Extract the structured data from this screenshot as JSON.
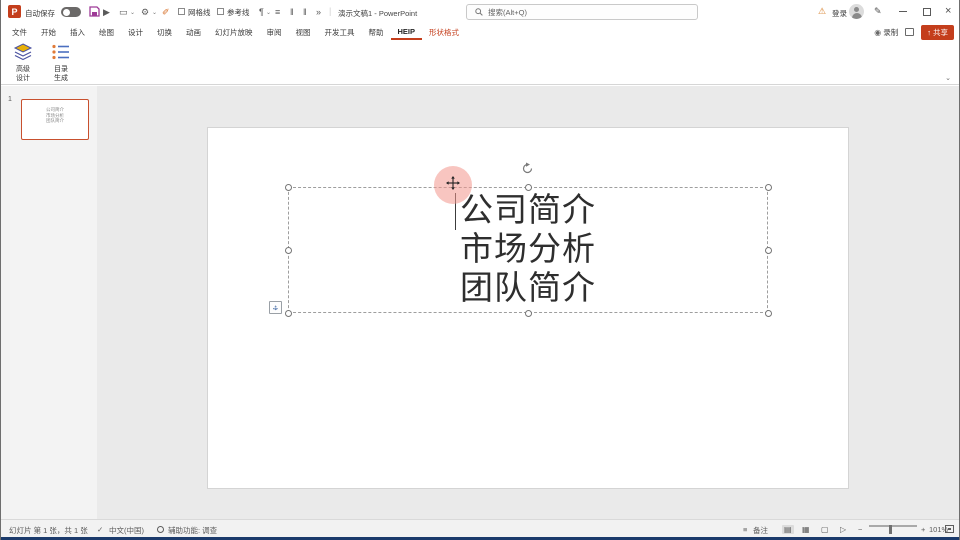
{
  "titlebar": {
    "autosave_label": "自动保存",
    "doc_title": "演示文稿1 - PowerPoint",
    "search_placeholder": "搜索(Alt+Q)",
    "signin_label": "登录",
    "gridlines_label": "网格线",
    "guides_label": "参考线"
  },
  "ribbon": {
    "tabs": [
      "文件",
      "开始",
      "插入",
      "绘图",
      "设计",
      "切换",
      "动画",
      "幻灯片放映",
      "审阅",
      "视图",
      "开发工具",
      "帮助",
      "HEIP",
      "形状格式"
    ],
    "record_label": "录制",
    "share_label": "共享",
    "design_button": {
      "line1": "高级",
      "line2": "设计"
    },
    "toc_button": {
      "line1": "目录",
      "line2": "生成"
    }
  },
  "slides_panel": {
    "slide_number": "1"
  },
  "slide": {
    "lines": [
      "公司简介",
      "市场分析",
      "团队简介"
    ]
  },
  "statusbar": {
    "slide_info": "幻灯片 第 1 张，共 1 张",
    "spell_glyph": "✓",
    "language": "中文(中国)",
    "accessibility": "辅助功能: 调查",
    "notes_label": "备注",
    "zoom_percent": "101%"
  },
  "icons": {
    "logo_letter": "P",
    "play": "▶",
    "shape": "▭",
    "gear": "⚙",
    "brush": "✐",
    "caret_down": "⌄",
    "paragraph": "¶",
    "align": "≡",
    "pipes": "‖",
    "overflow": "»",
    "separator": "|",
    "warning": "⚠",
    "pencil": "✎",
    "close": "×",
    "record_dot": "◉",
    "share_arrow": "↑",
    "notes": "≡",
    "view_normal": "▤",
    "view_sorter": "▦",
    "view_reading": "▢",
    "view_slideshow": "▷",
    "minus": "−",
    "plus": "+",
    "autofit_h": "↔",
    "autofit_v": "↕"
  },
  "colors": {
    "accent": "#c43e1c",
    "selection_pink": "#f2968d",
    "thumbnail_border": "#c8502e",
    "save_icon": "#9e3a97"
  }
}
